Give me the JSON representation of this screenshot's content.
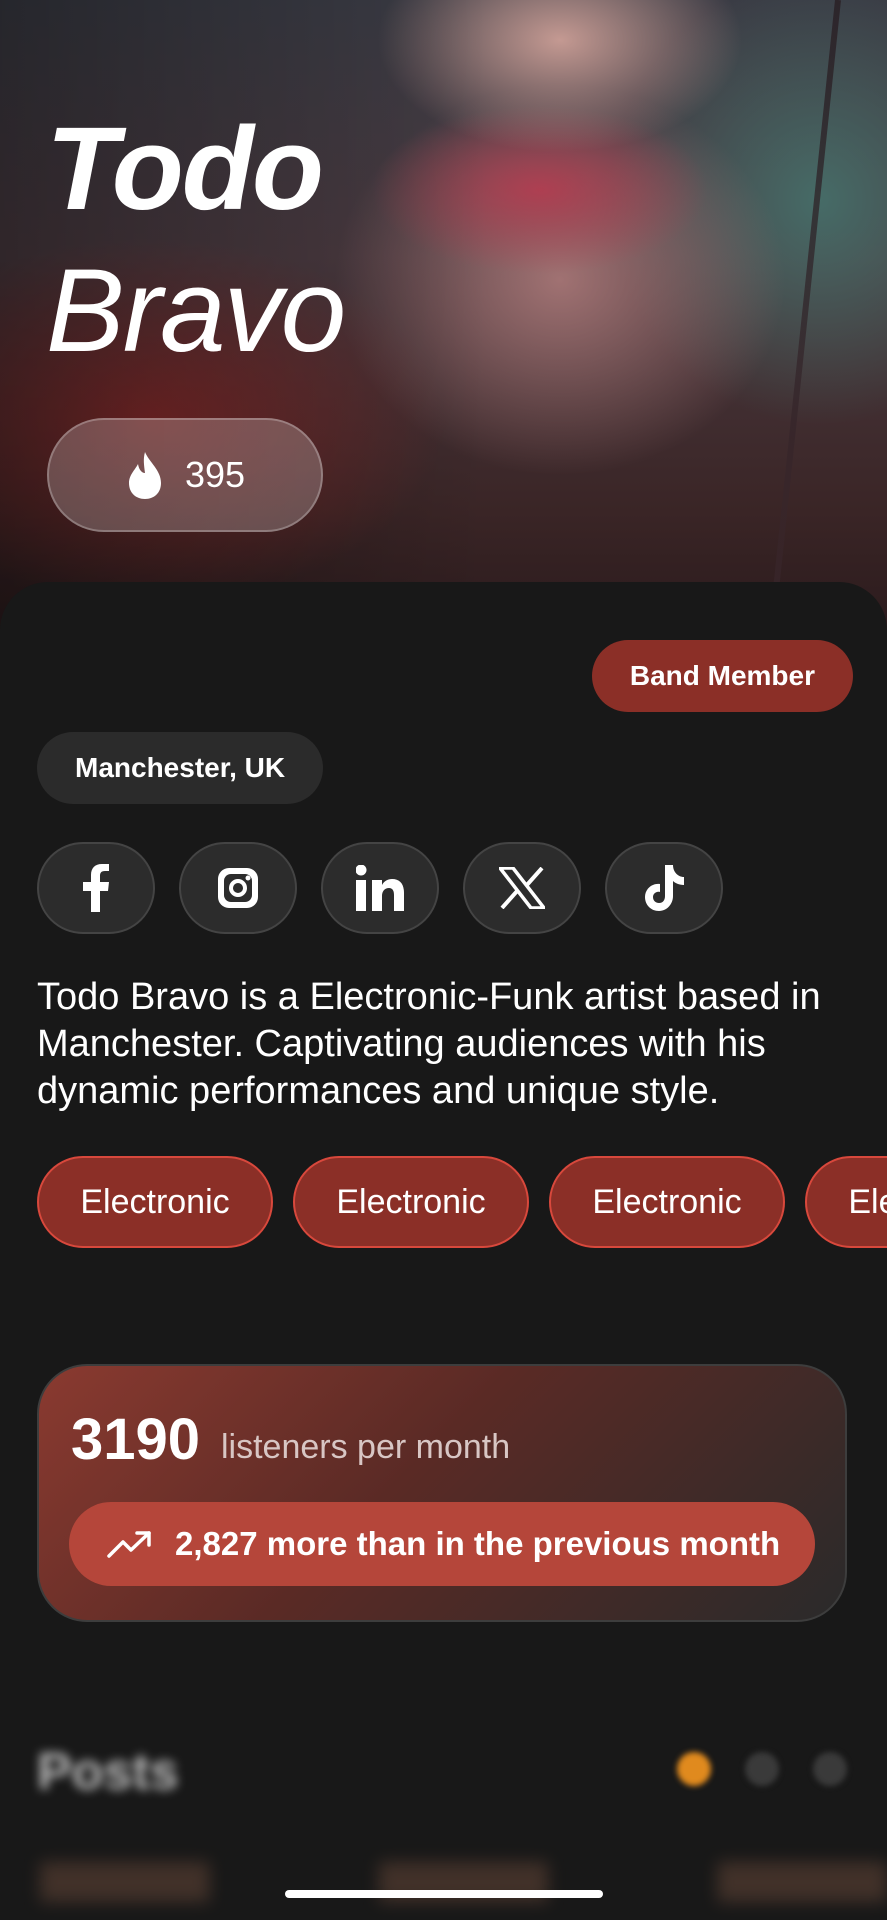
{
  "artist": {
    "first_name": "Todo",
    "last_name": "Bravo",
    "likes": "395",
    "role": "Band Member",
    "location": "Manchester, UK",
    "bio": "Todo Bravo is a Electronic-Funk artist based in Manchester. Captivating audiences with his dynamic performances and unique style."
  },
  "socials": [
    {
      "icon": "facebook-icon"
    },
    {
      "icon": "instagram-icon"
    },
    {
      "icon": "linkedin-icon"
    },
    {
      "icon": "x-icon"
    },
    {
      "icon": "tiktok-icon"
    }
  ],
  "genres": [
    "Electronic",
    "Electronic",
    "Electronic",
    "Electronic"
  ],
  "stats": {
    "listeners": "3190",
    "listeners_label": "listeners per month",
    "trend_text": "2,827 more than in the previous month"
  },
  "posts": {
    "title": "Posts"
  },
  "colors": {
    "accent": "#8b2f27",
    "accent_border": "#d8483c",
    "trend_bg": "#b5463a",
    "dot_active": "#e08a1e",
    "background": "#181818"
  }
}
